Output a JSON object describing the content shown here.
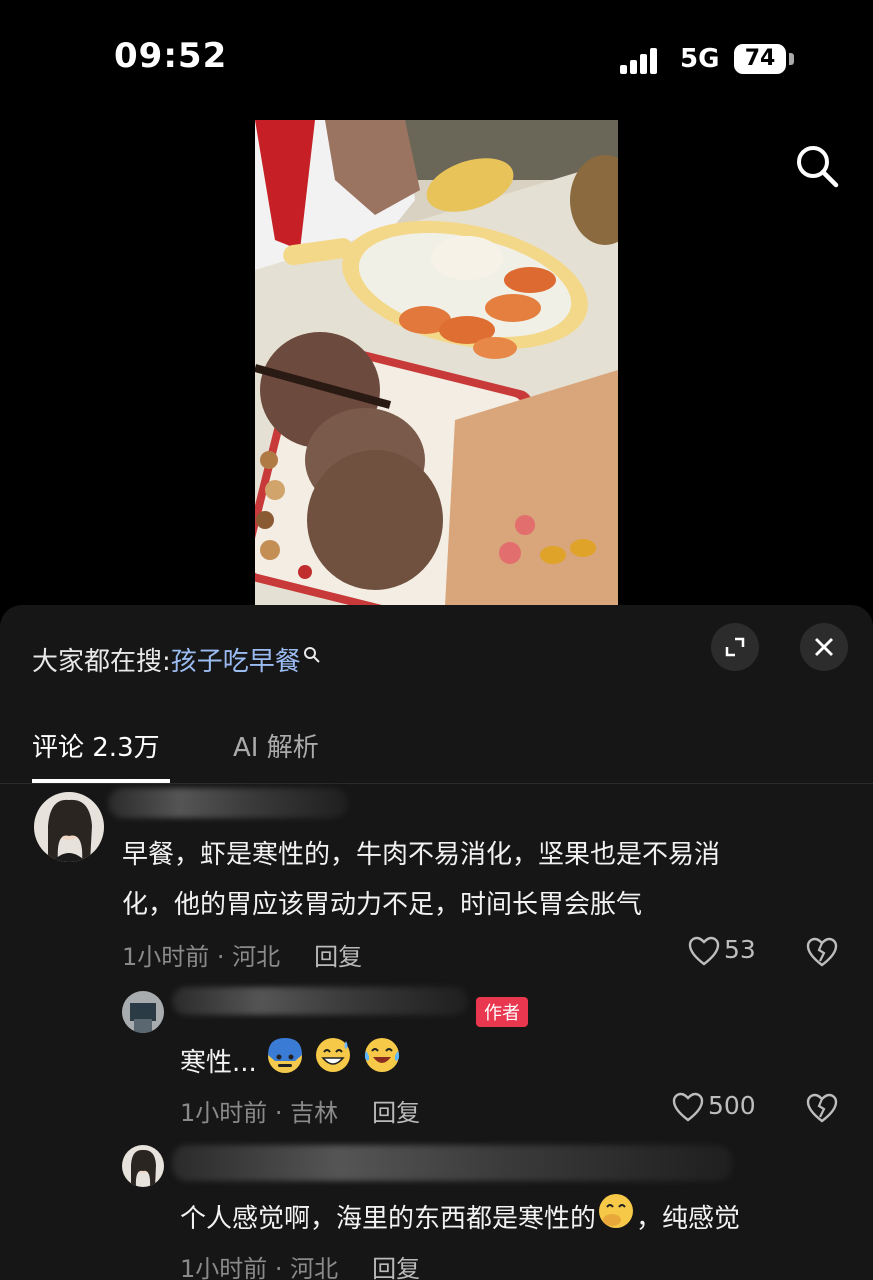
{
  "status": {
    "time": "09:52",
    "network": "5G",
    "battery": "74"
  },
  "hot_search": {
    "prefix": "大家都在搜:",
    "keyword": "孩子吃早餐"
  },
  "tabs": {
    "comments": "评论 2.3万",
    "ai": "AI 解析"
  },
  "comments": [
    {
      "text_line1": "早餐，虾是寒性的，牛肉不易消化，坚果也是不易消",
      "text_line2": "化，他的胃应该胃动力不足，时间长胃会胀气",
      "meta": "1小时前 · 河北",
      "reply": "回复",
      "likes": "53"
    },
    {
      "text": "寒性...",
      "author_tag": "作者",
      "meta": "1小时前 · 吉林",
      "reply": "回复",
      "likes": "500"
    },
    {
      "text": "个人感觉啊，海里的东西都是寒性的",
      "text_after": "，纯感觉",
      "meta": "1小时前 · 河北",
      "reply": "回复"
    }
  ],
  "colors": {
    "keyword": "#9bbcf2",
    "author_tag": "#e8374f",
    "panel": "#161616"
  }
}
